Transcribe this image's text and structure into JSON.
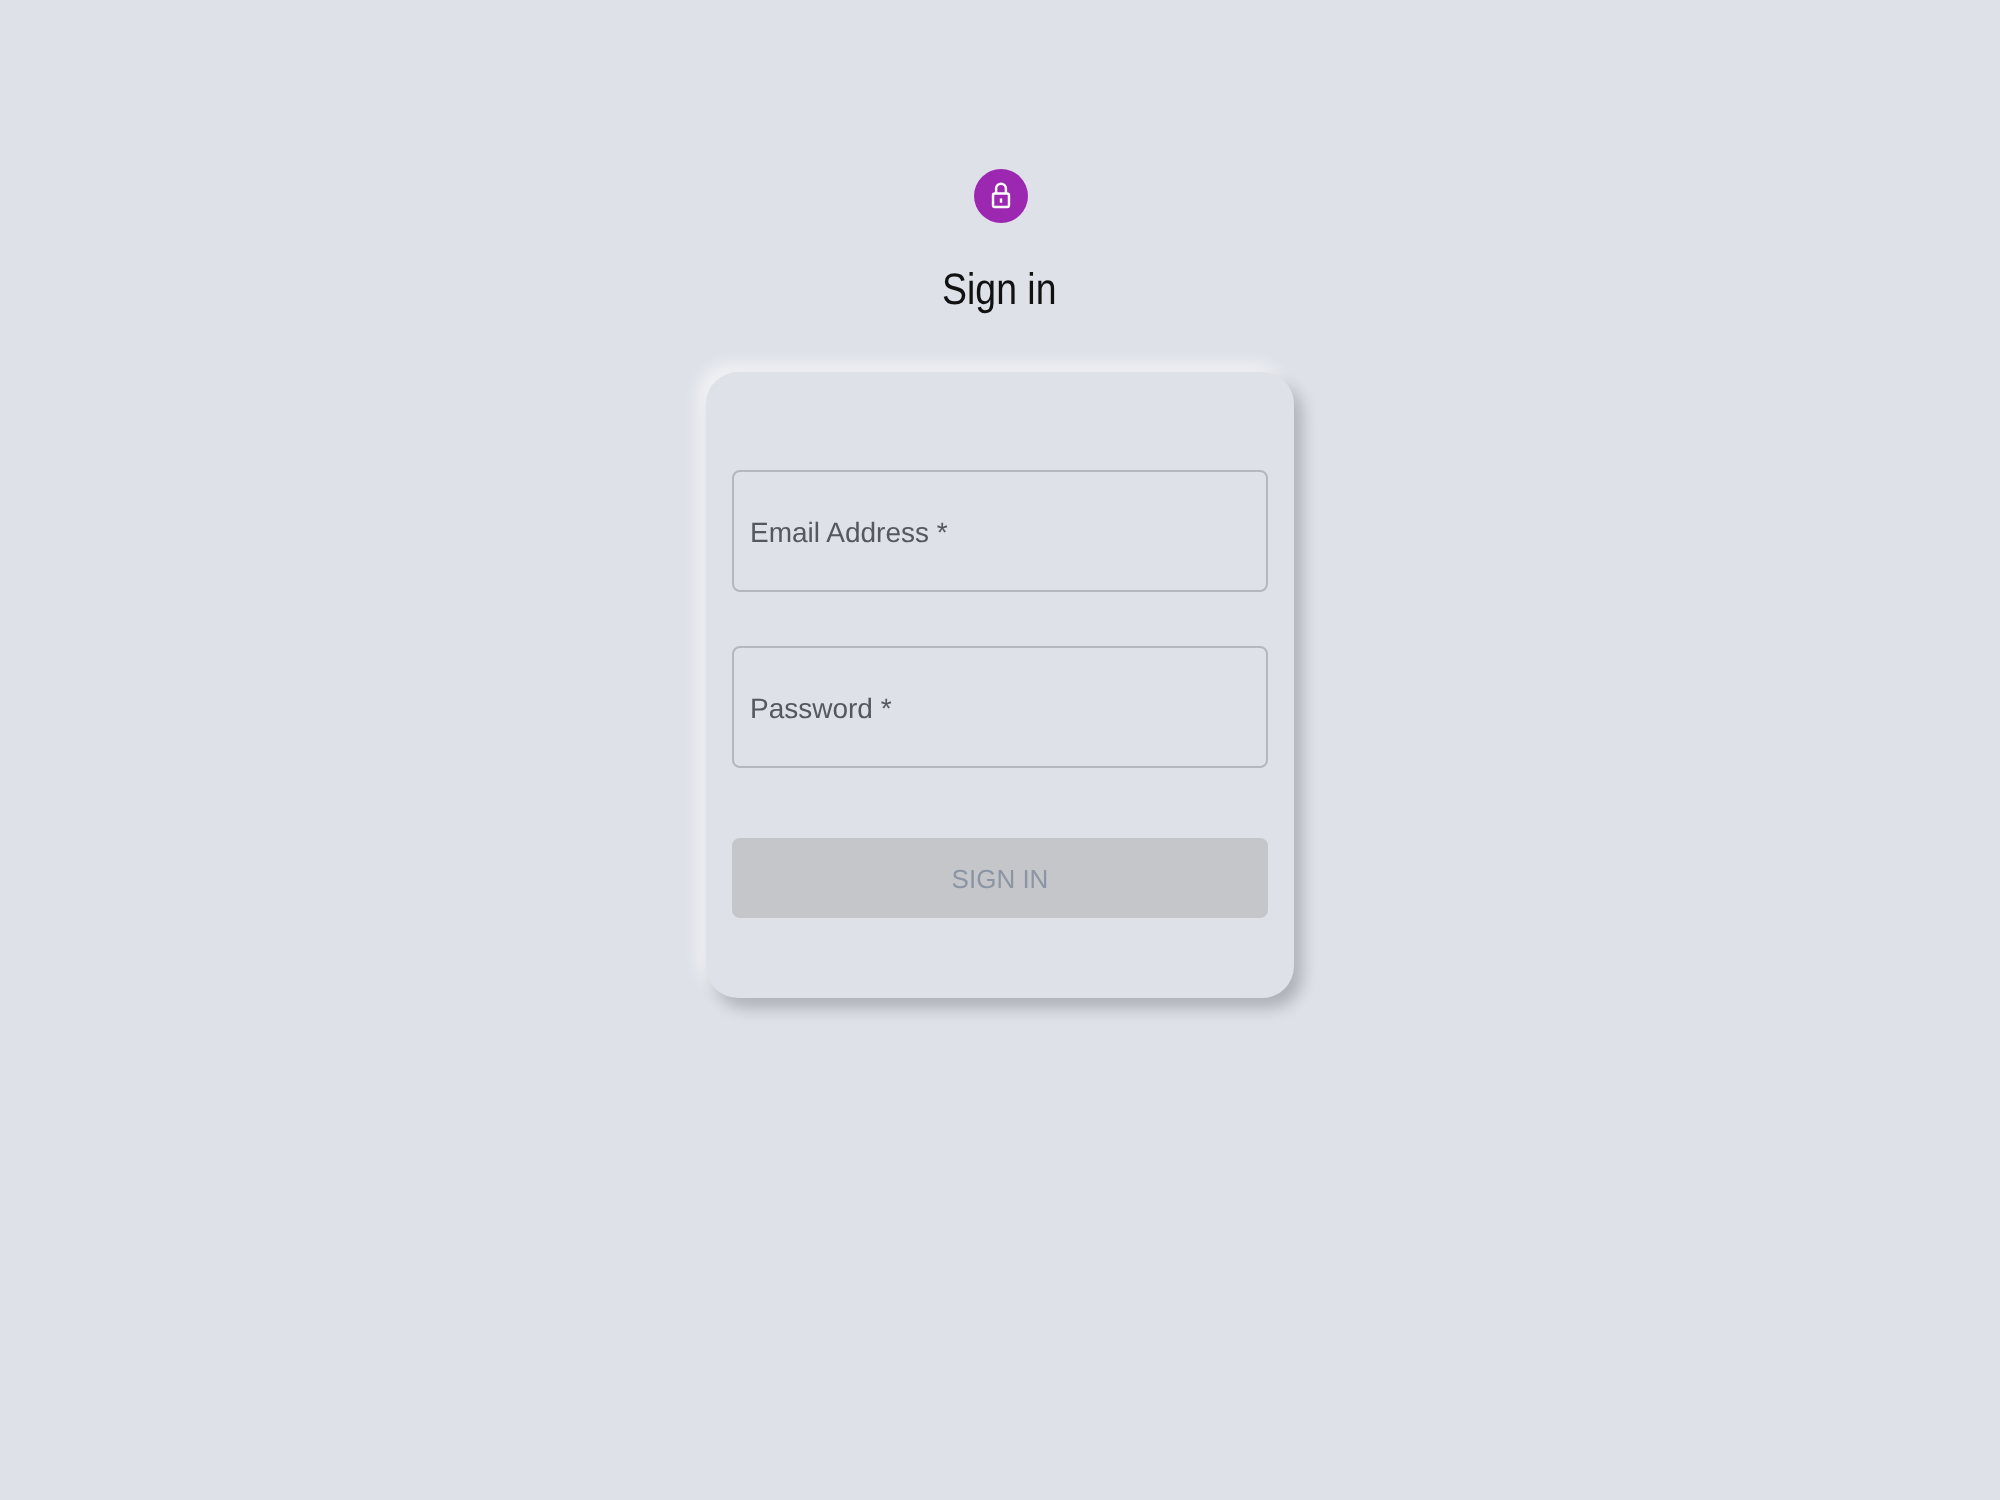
{
  "title": "Sign in",
  "fields": [
    {
      "placeholder": "Email Address *"
    },
    {
      "placeholder": "Password *"
    }
  ],
  "submit": {
    "label": "SIGN IN",
    "disabled": true
  }
}
